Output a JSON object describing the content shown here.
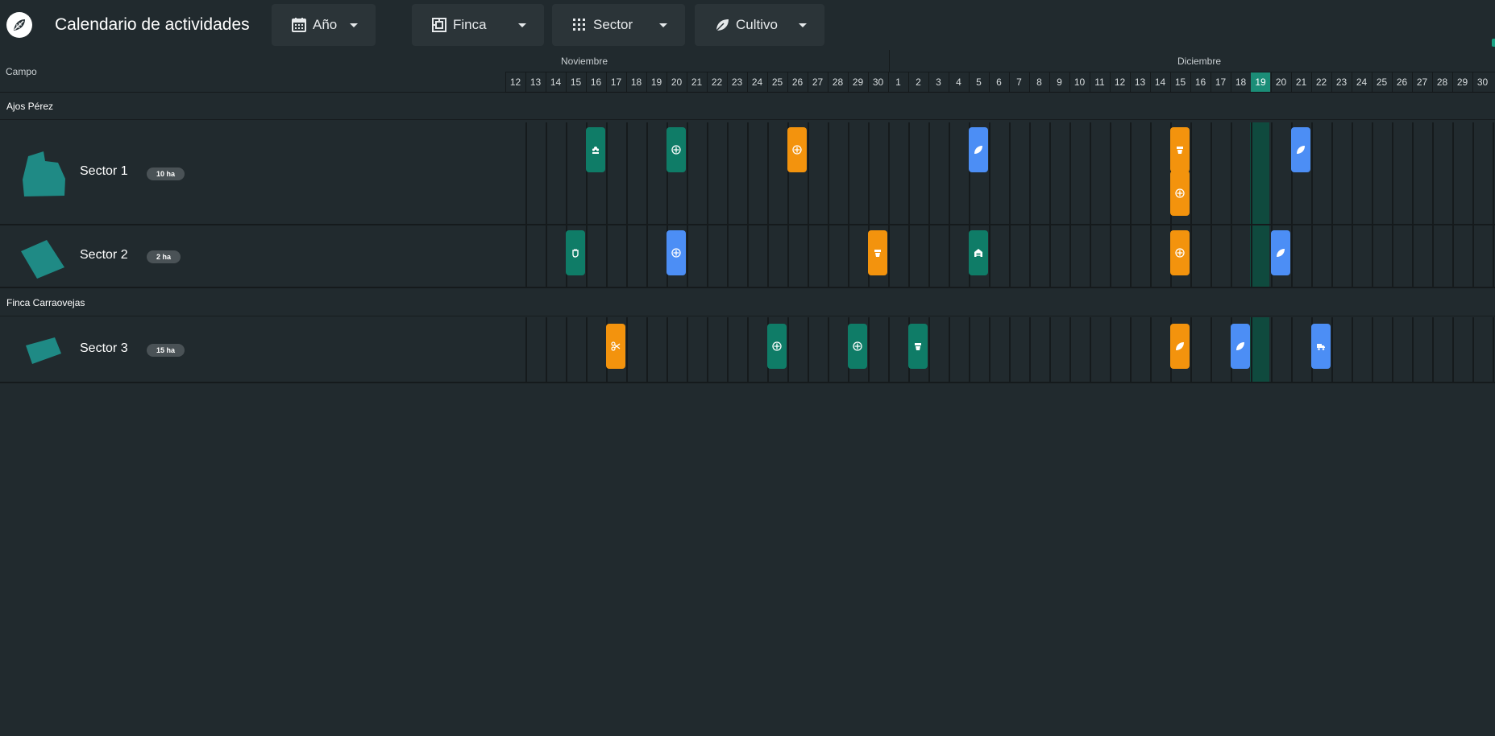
{
  "app": {
    "title": "Calendario de actividades"
  },
  "filters": [
    {
      "label": "Año",
      "icon": "calendar-icon"
    },
    {
      "label": "Finca",
      "icon": "parcel-icon"
    },
    {
      "label": "Sector",
      "icon": "grid-icon"
    },
    {
      "label": "Cultivo",
      "icon": "leaf-icon"
    }
  ],
  "table_header": {
    "campo": "Campo"
  },
  "months": [
    "Noviembre",
    "Diciembre"
  ],
  "days": [
    "12",
    "13",
    "14",
    "15",
    "16",
    "17",
    "18",
    "19",
    "20",
    "21",
    "22",
    "23",
    "24",
    "25",
    "26",
    "27",
    "28",
    "29",
    "30",
    "1",
    "2",
    "3",
    "4",
    "5",
    "6",
    "7",
    "8",
    "9",
    "10",
    "11",
    "12",
    "13",
    "14",
    "15",
    "16",
    "17",
    "18",
    "19",
    "20",
    "21",
    "22",
    "23",
    "24",
    "25",
    "26",
    "27",
    "28",
    "29",
    "30"
  ],
  "today": {
    "label": "19",
    "month": "Diciembre"
  },
  "groups": [
    {
      "name": "Ajos Pérez"
    },
    {
      "name": "Finca Carraovejas"
    }
  ],
  "sectors": [
    {
      "name": "Sector 1",
      "area": "10 ha",
      "group": "Ajos Pérez"
    },
    {
      "name": "Sector 2",
      "area": "2 ha",
      "group": "Ajos Pérez"
    },
    {
      "name": "Sector 3",
      "area": "15 ha",
      "group": "Finca Carraovejas"
    }
  ],
  "colors": {
    "green": "#0f7c67",
    "orange": "#f3930d",
    "blue": "#4c8ef5",
    "today": "#1b8d77",
    "background": "#212a2e"
  },
  "events": [
    {
      "sector": "Sector 1",
      "day": "16 Noviembre",
      "color": "green",
      "icon": "flower-icon"
    },
    {
      "sector": "Sector 1",
      "day": "20 Noviembre",
      "color": "green",
      "icon": "compass-icon"
    },
    {
      "sector": "Sector 1",
      "day": "26 Noviembre",
      "color": "orange",
      "icon": "compass-icon"
    },
    {
      "sector": "Sector 1",
      "day": "5 Diciembre",
      "color": "blue",
      "icon": "leaf-icon"
    },
    {
      "sector": "Sector 1",
      "day": "15 Diciembre",
      "color": "orange",
      "icon": "pot-icon"
    },
    {
      "sector": "Sector 1",
      "day": "15 Diciembre",
      "color": "orange",
      "icon": "compass-icon"
    },
    {
      "sector": "Sector 1",
      "day": "21 Diciembre",
      "color": "blue",
      "icon": "leaf-icon"
    },
    {
      "sector": "Sector 2",
      "day": "15 Noviembre",
      "color": "green",
      "icon": "hand-icon"
    },
    {
      "sector": "Sector 2",
      "day": "20 Noviembre",
      "color": "blue",
      "icon": "compass-icon"
    },
    {
      "sector": "Sector 2",
      "day": "30 Noviembre",
      "color": "orange",
      "icon": "pot-icon"
    },
    {
      "sector": "Sector 2",
      "day": "5 Diciembre",
      "color": "green",
      "icon": "warehouse-icon"
    },
    {
      "sector": "Sector 2",
      "day": "15 Diciembre",
      "color": "orange",
      "icon": "compass-icon"
    },
    {
      "sector": "Sector 2",
      "day": "20 Diciembre",
      "color": "blue",
      "icon": "leaf-icon"
    },
    {
      "sector": "Sector 3",
      "day": "17 Noviembre",
      "color": "orange",
      "icon": "scissors-icon"
    },
    {
      "sector": "Sector 3",
      "day": "25 Noviembre",
      "color": "green",
      "icon": "compass-icon"
    },
    {
      "sector": "Sector 3",
      "day": "29 Noviembre",
      "color": "green",
      "icon": "compass-icon"
    },
    {
      "sector": "Sector 3",
      "day": "2 Diciembre",
      "color": "green",
      "icon": "pot-icon"
    },
    {
      "sector": "Sector 3",
      "day": "15 Diciembre",
      "color": "orange",
      "icon": "leaf-icon"
    },
    {
      "sector": "Sector 3",
      "day": "18 Diciembre",
      "color": "blue",
      "icon": "leaf-icon"
    },
    {
      "sector": "Sector 3",
      "day": "22 Diciembre",
      "color": "blue",
      "icon": "truck-icon"
    }
  ]
}
